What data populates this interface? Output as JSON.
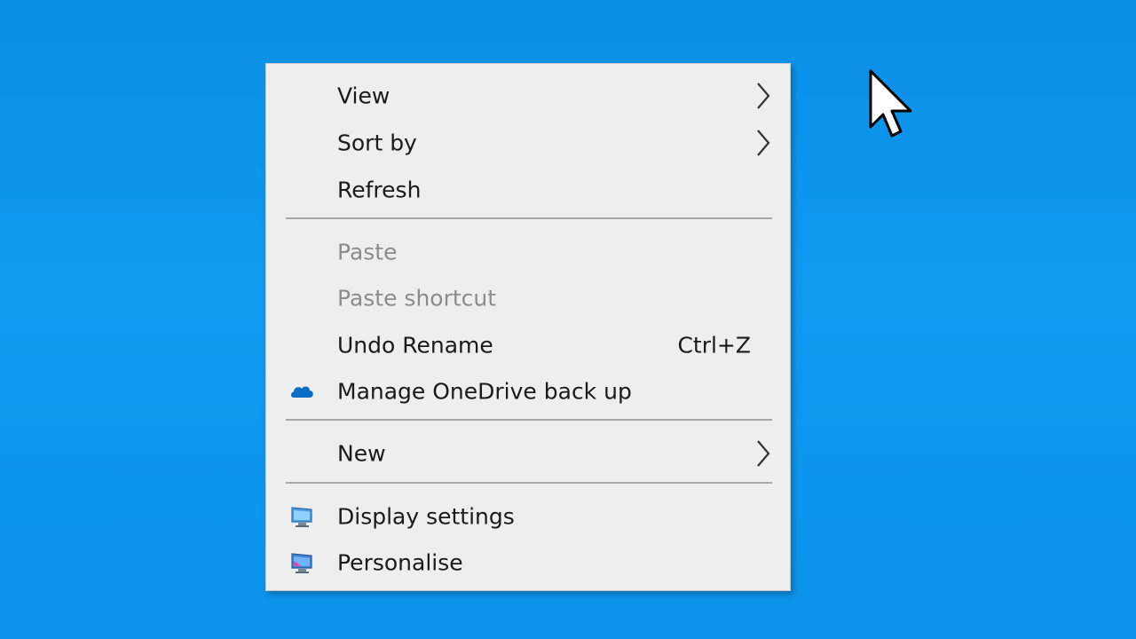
{
  "context_menu": {
    "items": [
      {
        "label": "View",
        "submenu": true,
        "enabled": true
      },
      {
        "label": "Sort by",
        "submenu": true,
        "enabled": true
      },
      {
        "label": "Refresh",
        "submenu": false,
        "enabled": true
      },
      {
        "label": "Paste",
        "submenu": false,
        "enabled": false
      },
      {
        "label": "Paste shortcut",
        "submenu": false,
        "enabled": false
      },
      {
        "label": "Undo Rename",
        "shortcut": "Ctrl+Z",
        "submenu": false,
        "enabled": true
      },
      {
        "label": "Manage OneDrive back up",
        "icon": "onedrive-cloud-icon",
        "submenu": false,
        "enabled": true
      },
      {
        "label": "New",
        "submenu": true,
        "enabled": true
      },
      {
        "label": "Display settings",
        "icon": "display-monitor-icon",
        "submenu": false,
        "enabled": true
      },
      {
        "label": "Personalise",
        "icon": "personalise-monitor-icon",
        "submenu": false,
        "enabled": true
      }
    ]
  },
  "colors": {
    "desktop_background": "#0c93ec",
    "menu_background": "#eeeeee",
    "text": "#1a1a1a",
    "disabled_text": "#8c8c8c",
    "separator": "#a9a9a9",
    "onedrive_blue": "#0a6fc2"
  },
  "cursor": {
    "icon": "mouse-pointer-icon"
  }
}
